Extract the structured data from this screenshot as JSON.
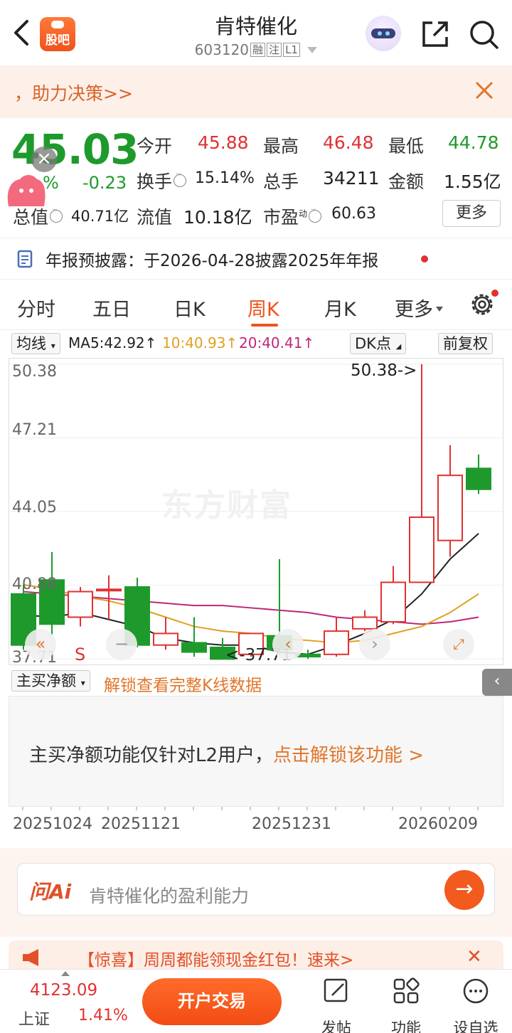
{
  "header": {
    "title": "肯特催化",
    "code": "603120",
    "tags": [
      "融",
      "注",
      "L1"
    ],
    "guba_label": "股吧"
  },
  "notice": {
    "text": "，助力决策>>"
  },
  "quote": {
    "price": "45.03",
    "change_pct": "%",
    "change": "-0.23",
    "fields": {
      "open_label": "今开",
      "open": "45.88",
      "high_label": "最高",
      "high": "46.48",
      "low_label": "最低",
      "low": "44.78",
      "turnover_label": "换手",
      "turnover": "15.14%",
      "volume_label": "总手",
      "volume": "34211",
      "amount_label": "金额",
      "amount": "1.55亿",
      "mktcap_label": "总值",
      "mktcap": "40.71亿",
      "float_label": "流值",
      "float": "10.18亿",
      "pe_label": "市盈",
      "pe_sup": "动",
      "pe": "60.63"
    },
    "more_label": "更多"
  },
  "report": {
    "text": "年报预披露：于2026-04-28披露2025年年报"
  },
  "tabs": [
    "分时",
    "五日",
    "日K",
    "周K",
    "月K",
    "更多"
  ],
  "active_tab": "周K",
  "ma_bar": {
    "selector": "均线",
    "ma5": "MA5:42.92↑",
    "ma10": "10:40.93↑",
    "ma20": "20:40.41↑",
    "dk": "DK点",
    "adjust": "前复权"
  },
  "colors": {
    "up": "#e03131",
    "down": "#1e9a2c",
    "accent": "#f0521c",
    "ma5": "#222222",
    "ma10": "#e0a020",
    "ma20": "#c0267a"
  },
  "chart_data": {
    "type": "candlestick",
    "y_ticks": [
      "50.38",
      "47.21",
      "44.05",
      "40.88",
      "37.71"
    ],
    "ylim": [
      37.71,
      50.38
    ],
    "x_ticks": [
      "20251024",
      "20251121",
      "20251231",
      "20260209"
    ],
    "max_annotation": "50.38->",
    "min_annotation": "<-37.71",
    "marker_S": "S",
    "watermark": "东方财富",
    "candles": [
      {
        "o": 40.5,
        "h": 40.9,
        "l": 38.1,
        "c": 38.3
      },
      {
        "o": 41.1,
        "h": 42.3,
        "l": 38.7,
        "c": 39.2
      },
      {
        "o": 39.5,
        "h": 40.8,
        "l": 39.1,
        "c": 40.6
      },
      {
        "o": 40.7,
        "h": 41.3,
        "l": 39.4,
        "c": 40.7
      },
      {
        "o": 40.8,
        "h": 41.2,
        "l": 38.2,
        "c": 38.3
      },
      {
        "o": 38.3,
        "h": 39.5,
        "l": 38.1,
        "c": 38.8
      },
      {
        "o": 38.4,
        "h": 39.5,
        "l": 37.8,
        "c": 38.0
      },
      {
        "o": 38.2,
        "h": 38.6,
        "l": 37.7,
        "c": 37.7
      },
      {
        "o": 37.9,
        "h": 38.8,
        "l": 37.8,
        "c": 38.8
      },
      {
        "o": 38.7,
        "h": 42.0,
        "l": 37.9,
        "c": 38.1
      },
      {
        "o": 37.9,
        "h": 38.1,
        "l": 37.7,
        "c": 37.8
      },
      {
        "o": 37.9,
        "h": 39.5,
        "l": 37.8,
        "c": 38.9
      },
      {
        "o": 39.0,
        "h": 39.8,
        "l": 38.9,
        "c": 39.5
      },
      {
        "o": 39.3,
        "h": 41.7,
        "l": 39.2,
        "c": 41.0
      },
      {
        "o": 41.0,
        "h": 50.38,
        "l": 41.0,
        "c": 43.8
      },
      {
        "o": 42.8,
        "h": 46.9,
        "l": 42.1,
        "c": 45.6
      },
      {
        "o": 45.9,
        "h": 46.5,
        "l": 44.8,
        "c": 45.0
      }
    ],
    "ma5": [
      39.6,
      39.5,
      39.7,
      39.4,
      39.1,
      38.6,
      38.4,
      38.3,
      38.3,
      38.0,
      37.9,
      38.3,
      38.8,
      39.4,
      40.5,
      42.0,
      43.1
    ],
    "ma10": [
      40.9,
      40.7,
      40.4,
      40.2,
      39.9,
      39.5,
      39.1,
      38.9,
      38.8,
      38.6,
      38.5,
      38.4,
      38.5,
      38.8,
      39.1,
      39.7,
      40.5
    ],
    "ma20": [
      40.6,
      40.5,
      40.4,
      40.3,
      40.2,
      40.1,
      40.0,
      40.0,
      39.9,
      39.8,
      39.7,
      39.5,
      39.4,
      39.3,
      39.2,
      39.3,
      39.5
    ]
  },
  "indicator": {
    "selector": "主买净额",
    "unlock": "解锁查看完整K线数据",
    "msg": "主买净额功能仅针对L2用户，",
    "msg_link": "点击解锁该功能 >"
  },
  "ai": {
    "logo": "问Ai",
    "placeholder": "肯特催化的盈利能力"
  },
  "promo": {
    "text": "【惊喜】周周都能领现金红包！速来>"
  },
  "bottom": {
    "index_value": "4123.09",
    "index_name": "上证",
    "index_pct": "1.41%",
    "trade": "开户交易",
    "post": "发帖",
    "func": "功能",
    "watch": "设自选"
  }
}
